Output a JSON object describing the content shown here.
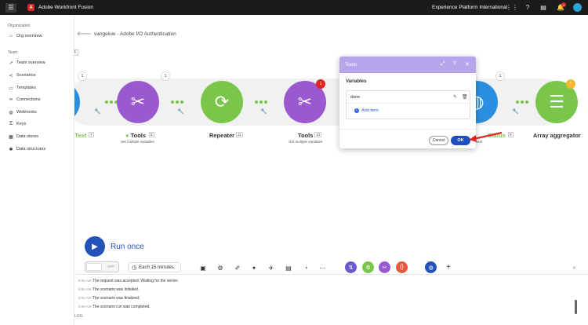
{
  "topbar": {
    "app_title": "Adobe Workfront Fusion",
    "org_name": "Experience Platform International",
    "notification_count": "1",
    "icons": [
      "menu-icon",
      "apps-grid-icon",
      "help-icon",
      "notifications-icon",
      "avatar"
    ]
  },
  "sidebar": {
    "org_section": "Organization",
    "org_items": [
      {
        "label": "Org overview",
        "icon": "home-icon"
      }
    ],
    "team_section": "Team",
    "team_items": [
      {
        "label": "Team overview",
        "icon": "chart-icon"
      },
      {
        "label": "Scenarios",
        "icon": "share-icon"
      },
      {
        "label": "Templates",
        "icon": "template-icon"
      },
      {
        "label": "Connections",
        "icon": "link-icon"
      },
      {
        "label": "Webhooks",
        "icon": "globe-icon"
      },
      {
        "label": "Keys",
        "icon": "key-icon"
      },
      {
        "label": "Data stores",
        "icon": "database-icon"
      },
      {
        "label": "Data structures",
        "icon": "structure-icon"
      }
    ]
  },
  "canvas": {
    "breadcrumb": "vangeluw - Adobe I/O Authentication",
    "partial_num": "4",
    "modules": [
      {
        "label": "nge Text",
        "num": "7",
        "color": "#2a8fe0"
      },
      {
        "label": "Tools",
        "num": "8",
        "sub": "Set multiple variables",
        "color": "#9b59d0",
        "badge": "1"
      },
      {
        "label": "Repeater",
        "num": "11",
        "color": "#7ac64a",
        "badge": "1"
      },
      {
        "label": "Tools",
        "num": "10",
        "sub": "Get multiple variables",
        "color": "#9b59d0",
        "badge": "1"
      },
      {
        "label": "Status",
        "num": "9",
        "sub": "request",
        "color": "#2a8fe0",
        "badge": "1"
      },
      {
        "label": "Array aggregator",
        "color": "#7ac64a"
      }
    ]
  },
  "modal": {
    "title": "Tools",
    "section_label": "Variables",
    "variable_name": "done",
    "add_item_label": "Add item",
    "cancel_label": "Cancel",
    "ok_label": "OK"
  },
  "controls": {
    "run_once_label": "Run once",
    "toggle_label": "OFF",
    "schedule_label": "Each 15 minutes."
  },
  "log": {
    "label": "LOG",
    "entries": [
      {
        "time": "9:56 AM",
        "message": "The request was accepted. Waiting for the server."
      },
      {
        "time": "9:56 AM",
        "message": "The scenario was initiated."
      },
      {
        "time": "9:56 AM",
        "message": "The scenario was finalized."
      },
      {
        "time": "9:56 AM",
        "message": "The scenario run was completed."
      }
    ]
  },
  "colors": {
    "accent": "#2352b8",
    "tools": "#9b59d0",
    "repeater": "#7ac64a",
    "http": "#2a8fe0",
    "modal_header": "#b7a5ec"
  }
}
